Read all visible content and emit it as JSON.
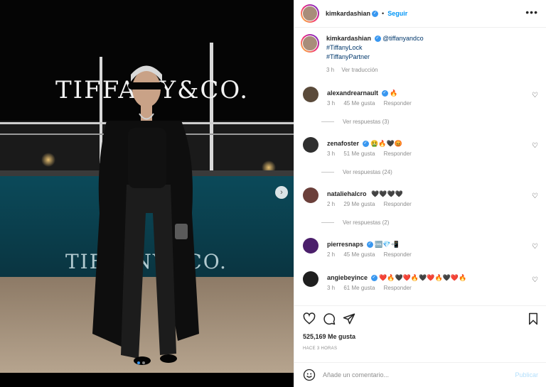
{
  "post": {
    "author": "kimkardashian",
    "follow_label": "Seguir",
    "separator": "•",
    "more": "•••"
  },
  "caption": {
    "author": "kimkardashian",
    "mention": "@tiffanyandco",
    "tags": [
      "#TiffanyLock",
      "#TiffanyPartner"
    ],
    "time": "3 h",
    "translate": "Ver traducción"
  },
  "comments": [
    {
      "user": "alexandrearnault",
      "text": "🔥",
      "time": "3 h",
      "likes": "45 Me gusta",
      "reply": "Responder",
      "replies": "Ver respuestas (3)",
      "avatar_color": "#5a4a3a"
    },
    {
      "user": "zenafoster",
      "text": "🤮🔥🖤😡",
      "time": "3 h",
      "likes": "51 Me gusta",
      "reply": "Responder",
      "replies": "Ver respuestas (24)",
      "avatar_color": "#2f2f2f"
    },
    {
      "user": "nataliehalcro",
      "text": "🖤🖤🖤🖤",
      "time": "2 h",
      "likes": "29 Me gusta",
      "reply": "Responder",
      "replies": "Ver respuestas (2)",
      "avatar_color": "#6b3f3a"
    },
    {
      "user": "pierresnaps",
      "text": "🆒💎📲",
      "time": "2 h",
      "likes": "45 Me gusta",
      "reply": "Responder",
      "replies": "",
      "avatar_color": "#4b1f6b"
    },
    {
      "user": "angiebeyince",
      "text": "❤️🔥🖤❤️🔥🖤❤️🔥🖤❤️🔥",
      "time": "3 h",
      "likes": "61 Me gusta",
      "reply": "Responder",
      "replies": "",
      "avatar_color": "#1f1f1f"
    }
  ],
  "stats": {
    "likes": "525,169 Me gusta",
    "ago": "HACE 3 HORAS"
  },
  "composer": {
    "placeholder": "Añade un comentario...",
    "publish": "Publicar"
  },
  "photo": {
    "sign_text": "TIFFANY&CO.",
    "reflection_text": "TIFFANY&CO."
  },
  "icons": {
    "next": "chevron-right-icon",
    "like": "heart-icon",
    "comment": "comment-icon",
    "share": "share-icon",
    "save": "bookmark-icon",
    "emoji": "emoji-icon",
    "more": "more-icon"
  },
  "colors": {
    "accent": "#0095f6",
    "verified": "#3897f0",
    "muted": "#8e8e8e",
    "hashtag": "#00376b"
  }
}
